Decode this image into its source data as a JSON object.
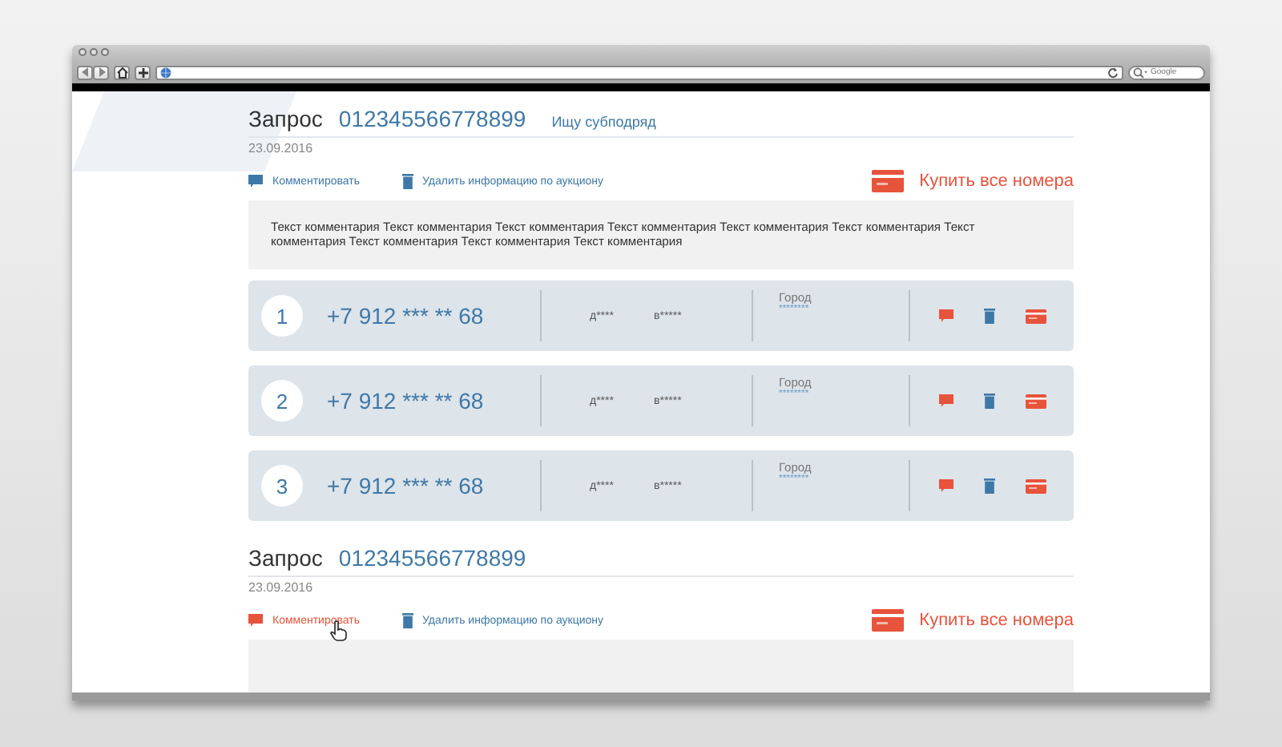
{
  "browser": {
    "search_placeholder": "Google"
  },
  "requests": [
    {
      "label": "Запрос",
      "number": "012345566778899",
      "tag": "Ищу субподряд",
      "date": "23.09.2016",
      "comment_action": {
        "label": "Комментировать",
        "hovered": false
      },
      "delete_action": "Удалить информацию по аукциону",
      "buy_all": "Купить все номера",
      "comment": "Текст комментария Текст комментария Текст комментария Текст комментария Текст комментария Текст комментария Текст комментария Текст комментария Текст комментария Текст комментария",
      "lots": [
        {
          "index": "1",
          "phone": "+7 912 *** ** 68",
          "field_1": "д****",
          "field_2": "в*****",
          "city_label": "Город",
          "city_value": "********"
        },
        {
          "index": "2",
          "phone": "+7 912 *** ** 68",
          "field_1": "д****",
          "field_2": "в*****",
          "city_label": "Город",
          "city_value": "********"
        },
        {
          "index": "3",
          "phone": "+7 912 *** ** 68",
          "field_1": "д****",
          "field_2": "в*****",
          "city_label": "Город",
          "city_value": "********"
        }
      ]
    },
    {
      "label": "Запрос",
      "number": "012345566778899",
      "date": "23.09.2016",
      "comment_action": {
        "label": "Комментировать",
        "hovered": true
      },
      "delete_action": "Удалить информацию по аукциону",
      "buy_all": "Купить все номера"
    }
  ]
}
